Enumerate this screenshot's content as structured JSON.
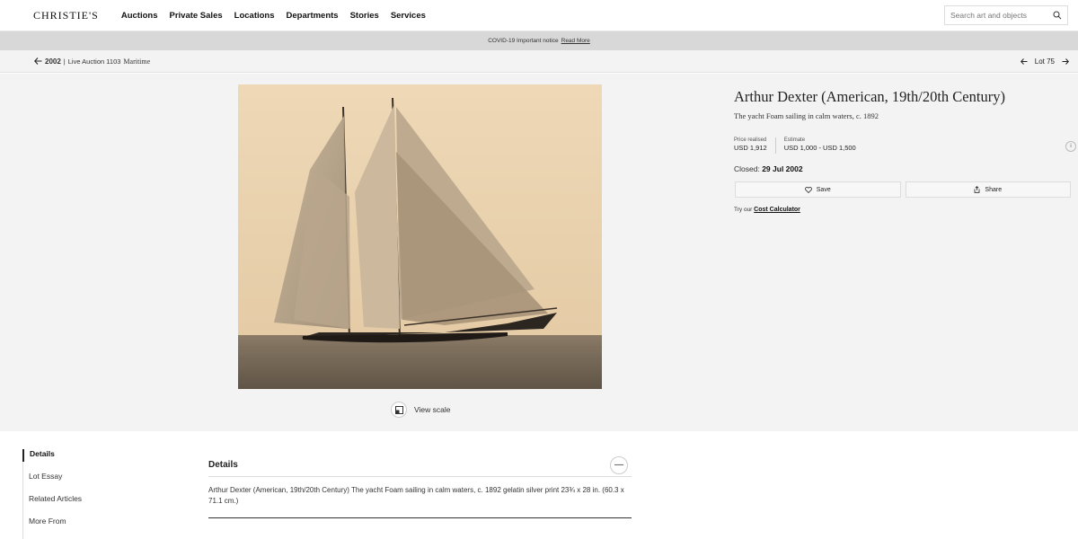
{
  "header": {
    "logo": "CHRISTIE'S",
    "nav": [
      "Auctions",
      "Private Sales",
      "Locations",
      "Departments",
      "Stories",
      "Services"
    ],
    "search_placeholder": "Search art and objects"
  },
  "notice": {
    "text": "COVID-19 Important notice",
    "link": "Read More"
  },
  "breadcrumb": {
    "year": "2002",
    "separator": "|",
    "sale_prefix": "Live Auction 1103",
    "sale_name": "Maritime",
    "lot_label": "Lot 75"
  },
  "lot": {
    "title": "Arthur Dexter (American, 19th/20th Century)",
    "subtitle": "The yacht Foam sailing in calm waters, c. 1892",
    "price_realised_label": "Price realised",
    "price_realised": "USD 1,912",
    "estimate_label": "Estimate",
    "estimate": "USD 1,000 - USD 1,500",
    "closed_label": "Closed:",
    "closed_date": "29 Jul 2002",
    "save_label": "Save",
    "share_label": "Share",
    "calc_prefix": "Try our",
    "calc_link": "Cost Calculator",
    "view_scale": "View scale",
    "info_glyph": "i"
  },
  "sidebar": {
    "items": [
      "Details",
      "Lot Essay",
      "Related Articles",
      "More From"
    ]
  },
  "details": {
    "heading": "Details",
    "collapse_glyph": "—",
    "text": "Arthur Dexter (American, 19th/20th Century) The yacht Foam sailing in calm waters, c. 1892 gelatin silver print 23¾ x 28 in. (60.3 x 71.1 cm.)"
  },
  "colors": {
    "notice_bg": "#d8d8d8",
    "page_grey": "#f3f3f3",
    "photo_sepia": "#e9d3b1"
  }
}
